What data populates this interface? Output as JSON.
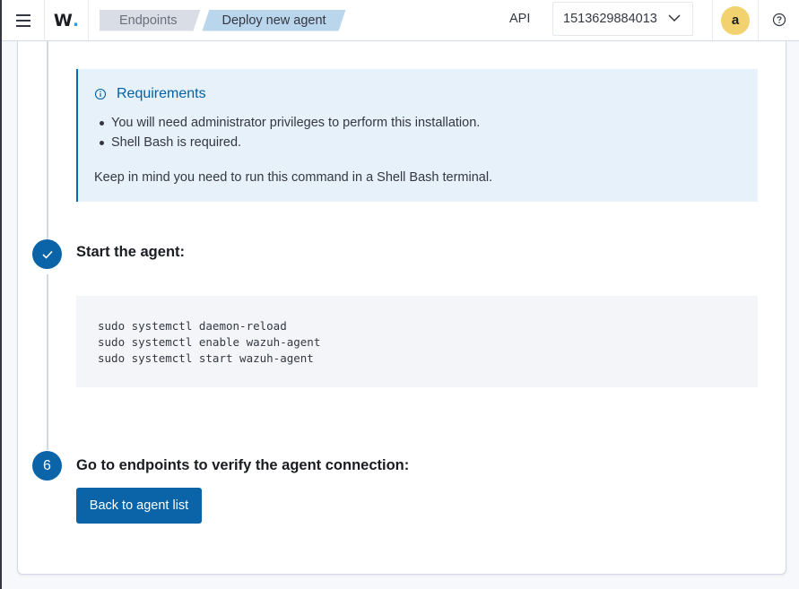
{
  "header": {
    "logo_text": "W",
    "logo_dot": ".",
    "breadcrumbs": [
      "Endpoints",
      "Deploy new agent"
    ],
    "api_label": "API",
    "api_value": "1513629884013",
    "avatar_letter": "a"
  },
  "requirements": {
    "title": "Requirements",
    "items": [
      "You will need administrator privileges to perform this installation.",
      "Shell Bash is required."
    ],
    "note": "Keep in mind you need to run this command in a Shell Bash terminal."
  },
  "steps": [
    {
      "title": "Start the agent:",
      "status": "complete",
      "code": [
        "sudo systemctl daemon-reload",
        "sudo systemctl enable wazuh-agent",
        "sudo systemctl start wazuh-agent"
      ]
    },
    {
      "number": "6",
      "title": "Go to endpoints to verify the agent connection:",
      "button_label": "Back to agent list"
    }
  ],
  "colors": {
    "primary": "#0b64a8",
    "callout_bg": "#e6f1fa",
    "avatar_bg": "#f2d26e"
  }
}
